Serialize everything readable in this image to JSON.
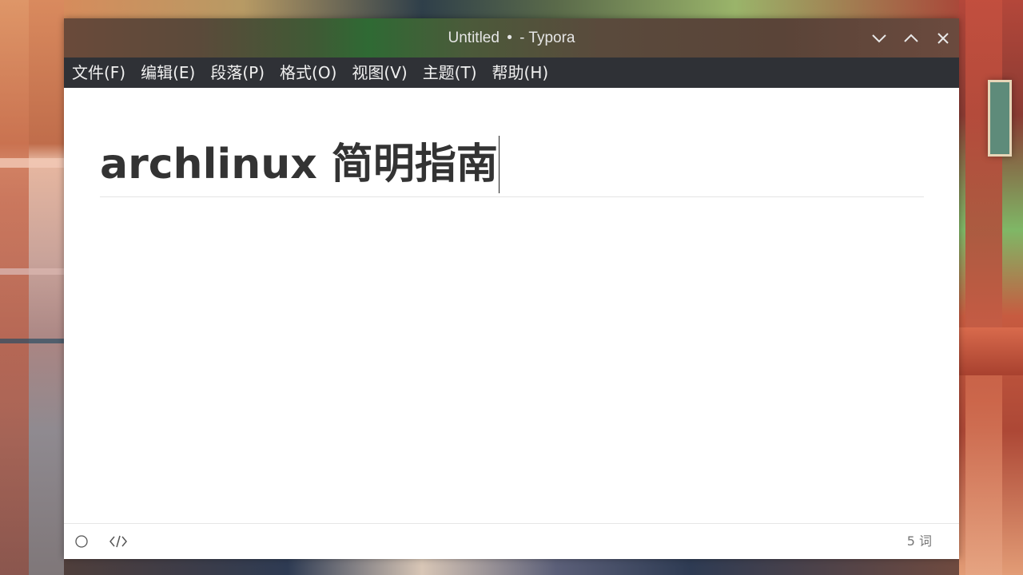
{
  "window": {
    "title_name": "Untitled",
    "title_dot": "•",
    "title_app": "- Typora"
  },
  "menu": {
    "items": [
      {
        "label": "文件(F)"
      },
      {
        "label": "编辑(E)"
      },
      {
        "label": "段落(P)"
      },
      {
        "label": "格式(O)"
      },
      {
        "label": "视图(V)"
      },
      {
        "label": "主题(T)"
      },
      {
        "label": "帮助(H)"
      }
    ]
  },
  "document": {
    "heading": "archlinux 简明指南"
  },
  "statusbar": {
    "word_count": "5 词",
    "left_icons": [
      "outline-toggle-icon",
      "source-code-icon"
    ]
  },
  "colors": {
    "menubar_bg": "#2f3136",
    "heading_text": "#333333",
    "editor_bg": "#ffffff"
  }
}
